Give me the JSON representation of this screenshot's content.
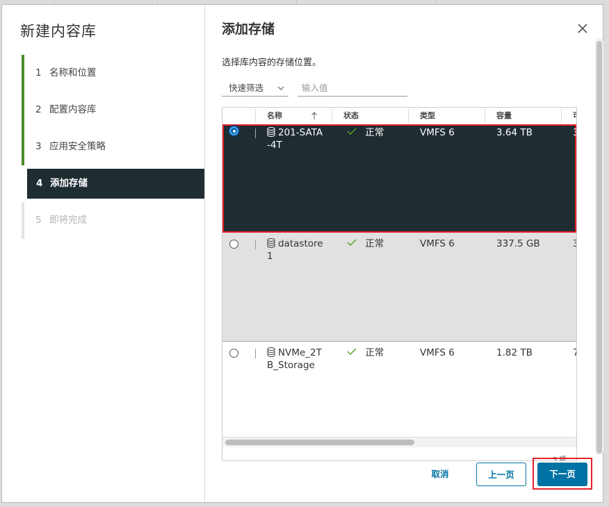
{
  "sidebar": {
    "title": "新建内容库",
    "steps": [
      {
        "num": "1",
        "label": "名称和位置"
      },
      {
        "num": "2",
        "label": "配置内容库"
      },
      {
        "num": "3",
        "label": "应用安全策略"
      },
      {
        "num": "4",
        "label": "添加存储"
      },
      {
        "num": "5",
        "label": "即将完成"
      }
    ],
    "active_step": "4"
  },
  "main": {
    "title": "添加存储",
    "subtitle": "选择库内容的存储位置。",
    "filter": {
      "select_value": "快速筛选",
      "input_placeholder": "输入值"
    },
    "columns": [
      "名称",
      "状态",
      "类型",
      "容量",
      "可"
    ],
    "rows": [
      {
        "name": "201-SATA-4T",
        "status": "正常",
        "type": "VMFS 6",
        "capacity": "3.64 TB",
        "extra": "3",
        "selected": true
      },
      {
        "name": "datastore1",
        "status": "正常",
        "type": "VMFS 6",
        "capacity": "337.5 GB",
        "extra": "3",
        "selected": false
      },
      {
        "name": "NVMe_2TB_Storage",
        "status": "正常",
        "type": "VMFS 6",
        "capacity": "1.82 TB",
        "extra": "7",
        "selected": false
      }
    ],
    "count": "3 项"
  },
  "footer": {
    "cancel": "取消",
    "back": "上一页",
    "next": "下一页"
  },
  "colors": {
    "accent": "#0072a3",
    "sidebar_active": "#1f2d33",
    "progress_bar": "#4a8c2a",
    "highlight": "#e4202a",
    "ok": "#5aa220"
  }
}
